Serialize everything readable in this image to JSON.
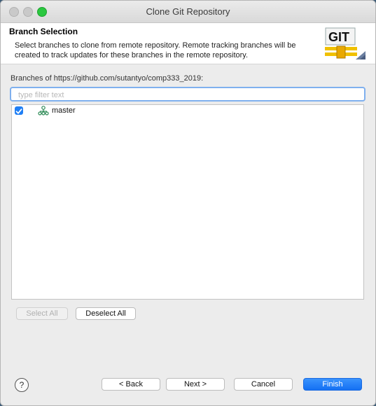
{
  "window": {
    "title": "Clone Git Repository"
  },
  "header": {
    "title": "Branch Selection",
    "description": "Select branches to clone from remote repository. Remote tracking branches will be created to track updates for these branches in the remote repository.",
    "logo_text": "GIT"
  },
  "branches": {
    "label": "Branches of https://github.com/sutantyo/comp333_2019:",
    "filter_placeholder": "type filter text",
    "items": [
      {
        "name": "master",
        "checked": true
      }
    ]
  },
  "selection_buttons": {
    "select_all": "Select All",
    "deselect_all": "Deselect All"
  },
  "footer": {
    "help": "?",
    "back": "< Back",
    "next": "Next >",
    "cancel": "Cancel",
    "finish": "Finish"
  },
  "colors": {
    "accent": "#1f7ff5",
    "branch_icon": "#2e8b57"
  }
}
